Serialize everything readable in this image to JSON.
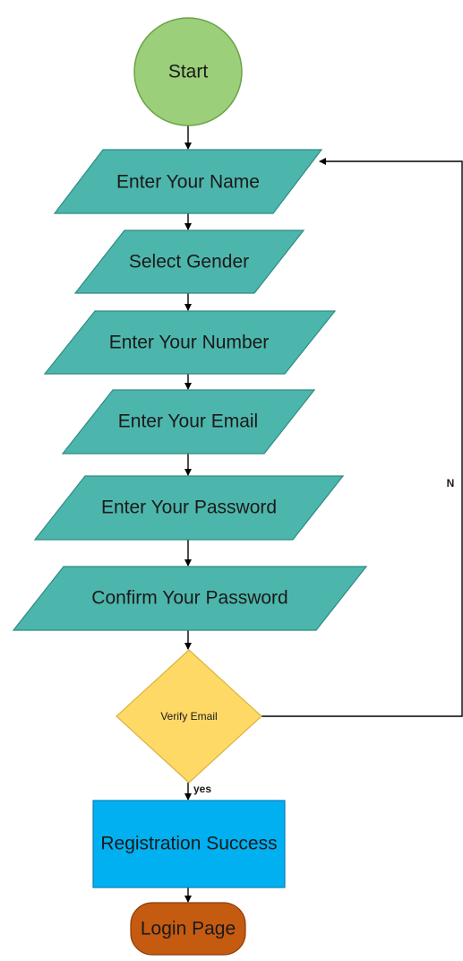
{
  "colors": {
    "start_fill": "#9BCF7A",
    "start_stroke": "#6BA347",
    "io_fill": "#4DB6AC",
    "io_stroke": "#2E8B84",
    "decision_fill": "#FFD966",
    "decision_stroke": "#D9B441",
    "process_fill": "#00B0F0",
    "process_stroke": "#0A7FB8",
    "end_fill": "#C55A11",
    "end_stroke": "#8C3E0B"
  },
  "nodes": {
    "start": {
      "label": "Start",
      "shape": "circle"
    },
    "enter_name": {
      "label": "Enter Your Name",
      "shape": "parallelogram"
    },
    "select_gender": {
      "label": "Select Gender",
      "shape": "parallelogram"
    },
    "enter_number": {
      "label": "Enter Your Number",
      "shape": "parallelogram"
    },
    "enter_email": {
      "label": "Enter Your Email",
      "shape": "parallelogram"
    },
    "enter_password": {
      "label": "Enter Your Password",
      "shape": "parallelogram"
    },
    "confirm_password": {
      "label": "Confirm Your Password",
      "shape": "parallelogram"
    },
    "verify_email": {
      "label": "Verify Email",
      "shape": "diamond"
    },
    "registration_success": {
      "label": "Registration Success",
      "shape": "rectangle"
    },
    "login_page": {
      "label": "Login Page",
      "shape": "rounded-rectangle"
    }
  },
  "edges": {
    "no_label": "N",
    "yes_label": "yes"
  }
}
